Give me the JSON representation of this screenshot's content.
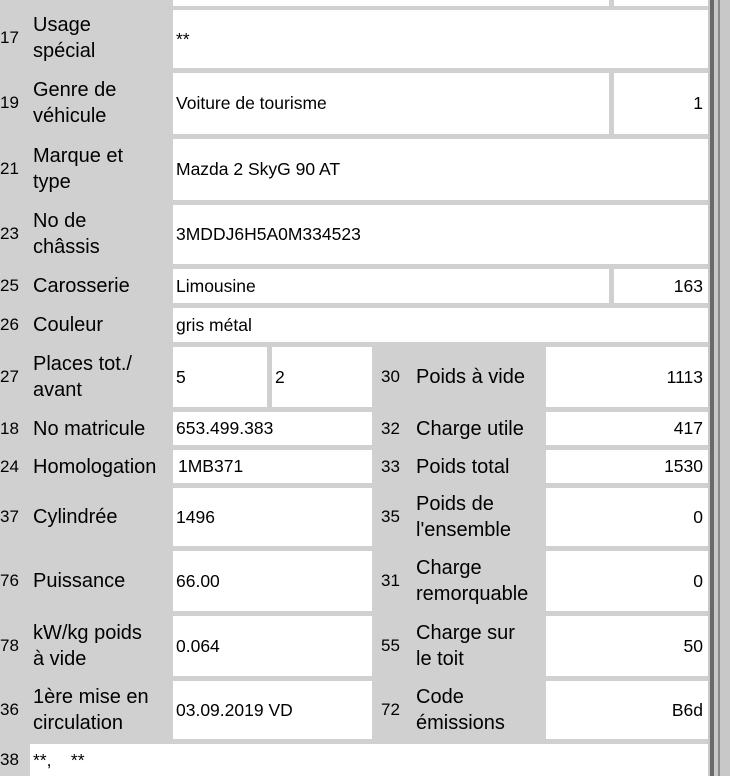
{
  "rows": {
    "r15": {
      "value": ""
    },
    "r17": {
      "num": "17",
      "label1": "Usage",
      "label2": "spécial",
      "value": "**"
    },
    "r19": {
      "num": "19",
      "label1": "Genre de",
      "label2": "véhicule",
      "value": "Voiture de tourisme",
      "code": "1"
    },
    "r21": {
      "num": "21",
      "label1": "Marque et",
      "label2": "type",
      "value": "Mazda 2 SkyG 90 AT"
    },
    "r23": {
      "num": "23",
      "label1": "No de",
      "label2": "châssis",
      "value": "3MDDJ6H5A0M334523"
    },
    "r25": {
      "num": "25",
      "label": "Carosserie",
      "value": "Limousine",
      "code": "163"
    },
    "r26": {
      "num": "26",
      "label": "Couleur",
      "value": "gris métal"
    },
    "r27": {
      "num": "27",
      "label1": "Places tot./",
      "label2": "avant",
      "value1": "5",
      "value2": "2",
      "rnum": "30",
      "rlabel": "Poids à vide",
      "rvalue": "1113"
    },
    "r18": {
      "num": "18",
      "label": "No matricule",
      "value": "653.499.383",
      "rnum": "32",
      "rlabel": "Charge utile",
      "rvalue": "417"
    },
    "r24": {
      "num": "24",
      "label": "Homologation",
      "value": "1MB371",
      "rnum": "33",
      "rlabel": "Poids total",
      "rvalue": "1530"
    },
    "r37": {
      "num": "37",
      "label": "Cylindrée",
      "value": "1496",
      "rnum": "35",
      "rlabel1": "Poids de",
      "rlabel2": "l'ensemble",
      "rvalue": "0"
    },
    "r76": {
      "num": "76",
      "label": "Puissance",
      "value": "66.00",
      "rnum": "31",
      "rlabel1": "Charge",
      "rlabel2": "remorquable",
      "rvalue": "0"
    },
    "r78": {
      "num": "78",
      "label1": "kW/kg poids",
      "label2": "à vide",
      "value": "0.064",
      "rnum": "55",
      "rlabel1": "Charge sur",
      "rlabel2": "le toit",
      "rvalue": "50"
    },
    "r36": {
      "num": "36",
      "label1": "1ère mise en",
      "label2": "circulation",
      "value": "03.09.2019 VD",
      "rnum": "72",
      "rlabel1": "Code",
      "rlabel2": "émissions",
      "rvalue": "B6d"
    },
    "r38": {
      "num": "38",
      "value": "**,    **"
    }
  }
}
